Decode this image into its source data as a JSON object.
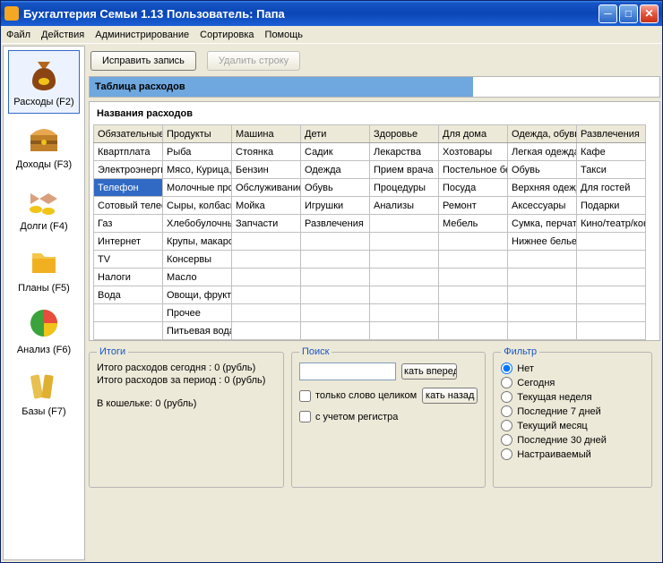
{
  "window": {
    "title": "Бухгалтерия Семьи 1.13     Пользователь: Папа"
  },
  "menu": {
    "items": [
      "Файл",
      "Действия",
      "Администрирование",
      "Сортировка",
      "Помощь"
    ]
  },
  "sidebar": {
    "items": [
      {
        "label": "Расходы (F2)"
      },
      {
        "label": "Доходы (F3)"
      },
      {
        "label": "Долги (F4)"
      },
      {
        "label": "Планы (F5)"
      },
      {
        "label": "Анализ (F6)"
      },
      {
        "label": "Базы (F7)"
      }
    ]
  },
  "toolbar": {
    "edit_label": "Исправить запись",
    "delete_label": "Удалить строку"
  },
  "banner": {
    "label": "Таблица расходов"
  },
  "table": {
    "heading": "Названия расходов",
    "columns": [
      "Обязательные",
      "Продукты",
      "Машина",
      "Дети",
      "Здоровье",
      "Для дома",
      "Одежда, обувь",
      "Развлечения"
    ],
    "rows": [
      [
        "Квартплата",
        "Рыба",
        "Стоянка",
        "Садик",
        "Лекарства",
        "Хозтовары",
        "Легкая одежда",
        "Кафе"
      ],
      [
        "Электроэнергия",
        "Мясо, Курица, Свинина",
        "Бензин",
        "Одежда",
        "Прием врача",
        "Постельное белье",
        "Обувь",
        "Такси"
      ],
      [
        "Телефон",
        "Молочные продукты",
        "Обслуживание",
        "Обувь",
        "Процедуры",
        "Посуда",
        "Верхняя одежда",
        "Для гостей"
      ],
      [
        "Сотовый телефон",
        "Сыры, колбасы",
        "Мойка",
        "Игрушки",
        "Анализы",
        "Ремонт",
        "Аксессуары",
        "Подарки"
      ],
      [
        "Газ",
        "Хлебобулочные",
        "Запчасти",
        "Развлечения",
        "",
        "Мебель",
        "Сумка, перчатки",
        "Кино/театр/концерт"
      ],
      [
        "Интернет",
        "Крупы, макароны",
        "",
        "",
        "",
        "",
        "Нижнее белье",
        ""
      ],
      [
        "TV",
        "Консервы",
        "",
        "",
        "",
        "",
        "",
        ""
      ],
      [
        "Налоги",
        "Масло",
        "",
        "",
        "",
        "",
        "",
        ""
      ],
      [
        "Вода",
        "Овощи, фрукты",
        "",
        "",
        "",
        "",
        "",
        ""
      ],
      [
        "",
        "Прочее",
        "",
        "",
        "",
        "",
        "",
        ""
      ],
      [
        "",
        "Питьевая вода",
        "",
        "",
        "",
        "",
        "",
        ""
      ]
    ],
    "selected": {
      "row": 2,
      "col": 0
    }
  },
  "totals": {
    "legend": "Итоги",
    "today": "Итого расходов сегодня : 0 (рубль)",
    "period": "Итого расходов за период : 0 (рубль)",
    "wallet": "В кошельке: 0 (рубль)"
  },
  "search": {
    "legend": "Поиск",
    "forward": "кать вперед",
    "backward": "кать назад",
    "whole_word": "только слово целиком",
    "match_case": "с учетом регистра"
  },
  "filter": {
    "legend": "Фильтр",
    "options": [
      "Нет",
      "Сегодня",
      "Текущая неделя",
      "Последние 7 дней",
      "Текущий месяц",
      "Последние 30 дней",
      "Настраиваемый"
    ],
    "selected": 0
  }
}
